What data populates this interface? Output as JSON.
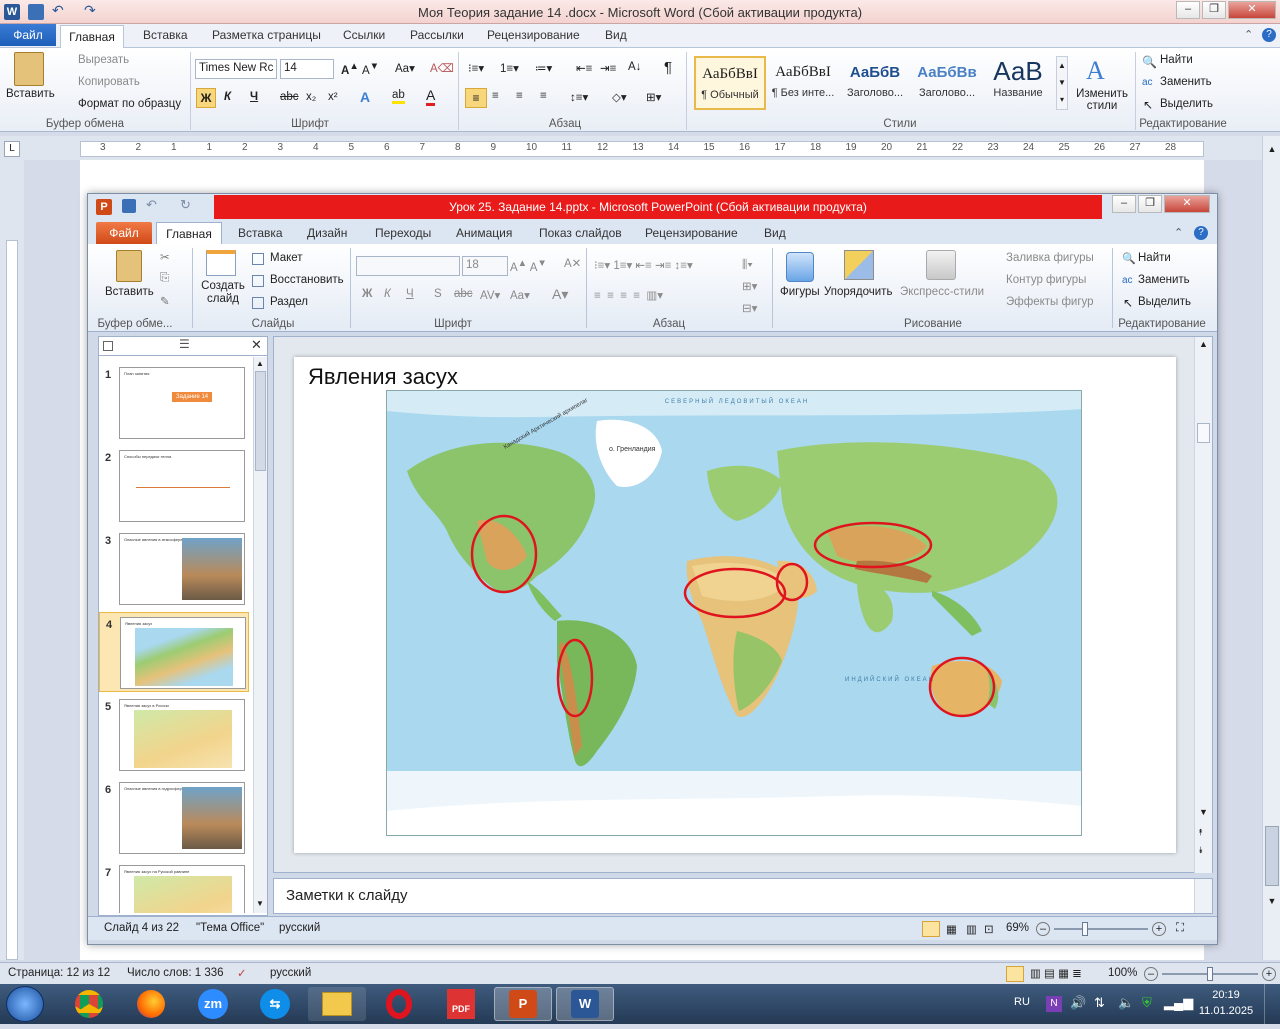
{
  "word": {
    "title": "Моя Теория задание 14 .docx  -  Microsoft Word (Сбой активации продукта)",
    "tabs": [
      "Файл",
      "Главная",
      "Вставка",
      "Разметка страницы",
      "Ссылки",
      "Рассылки",
      "Рецензирование",
      "Вид"
    ],
    "clipboard": {
      "paste": "Вставить",
      "cut": "Вырезать",
      "copy": "Копировать",
      "format": "Формат по образцу",
      "group": "Буфер обмена"
    },
    "font": {
      "name": "Times New Rc",
      "size": "14",
      "group": "Шрифт",
      "bold": "Ж",
      "italic": "К",
      "underline": "Ч"
    },
    "paragraph": {
      "group": "Абзац",
      "pilcrow": "¶"
    },
    "styles": {
      "group": "Стили",
      "items": [
        {
          "sample": "АаБбВвІ",
          "name": "¶ Обычный"
        },
        {
          "sample": "АаБбВвІ",
          "name": "¶ Без инте..."
        },
        {
          "sample": "АаБбВ",
          "name": "Заголово..."
        },
        {
          "sample": "АаБбВв",
          "name": "Заголово..."
        },
        {
          "sample": "АаВ",
          "name": "Название"
        }
      ],
      "change": "Изменить стили"
    },
    "editing": {
      "group": "Редактирование",
      "find": "Найти",
      "replace": "Заменить",
      "select": "Выделить"
    },
    "ruler_numbers": [
      "3",
      "2",
      "1",
      "1",
      "2",
      "3",
      "4",
      "5",
      "6",
      "7",
      "8",
      "9",
      "10",
      "11",
      "12",
      "13",
      "14",
      "15",
      "16",
      "17",
      "18",
      "19",
      "20",
      "21",
      "22",
      "23",
      "24",
      "25",
      "26",
      "27",
      "28"
    ],
    "status": {
      "page": "Страница: 12 из 12",
      "words": "Число слов: 1 336",
      "lang": "русский",
      "zoom": "100%"
    }
  },
  "ppt": {
    "title": "Урок 25. Задание 14.pptx  -  Microsoft PowerPoint (Сбой активации продукта)",
    "tabs": [
      "Файл",
      "Главная",
      "Вставка",
      "Дизайн",
      "Переходы",
      "Анимация",
      "Показ слайдов",
      "Рецензирование",
      "Вид"
    ],
    "clipboard": {
      "paste": "Вставить",
      "group": "Буфер обме..."
    },
    "slides": {
      "create": "Создать слайд",
      "layout": "Макет",
      "reset": "Восстановить",
      "section": "Раздел",
      "group": "Слайды"
    },
    "font": {
      "size": "18",
      "group": "Шрифт",
      "bold": "Ж",
      "italic": "К",
      "underline": "Ч",
      "shadow": "S",
      "strike": "abc"
    },
    "paragraph": {
      "group": "Абзац"
    },
    "drawing": {
      "shapes": "Фигуры",
      "arrange": "Упорядочить",
      "quick": "Экспресс-стили",
      "fill": "Заливка фигуры",
      "outline": "Контур фигуры",
      "effects": "Эффекты фигур",
      "group": "Рисование"
    },
    "editing": {
      "find": "Найти",
      "replace": "Заменить",
      "select": "Выделить",
      "group": "Редактирование"
    },
    "thumbs": [
      {
        "num": "1",
        "title": "План занятия",
        "tag": "Задание 14"
      },
      {
        "num": "2",
        "title": "Способы передачи тепла"
      },
      {
        "num": "3",
        "title": "Опасные явления в атмосфере"
      },
      {
        "num": "4",
        "title": "Явления засух"
      },
      {
        "num": "5",
        "title": "Явления засух в России"
      },
      {
        "num": "6",
        "title": "Опасные явления в гидросфере"
      },
      {
        "num": "7",
        "title": "Явления засух на Русской равнине"
      }
    ],
    "slide": {
      "title": "Явления засух",
      "map_labels": {
        "arctic": "СЕВЕРНЫЙ ЛЕДОВИТЫЙ ОКЕАН",
        "greenland": "о. Гренландия",
        "arch": "Канадский Арктический архипелаг",
        "indian": "ИНДИЙСКИЙ ОКЕАН"
      }
    },
    "notes": "Заметки к слайду",
    "status": {
      "slide": "Слайд 4 из 22",
      "theme": "\"Тема Office\"",
      "lang": "русский",
      "zoom": "69%"
    }
  },
  "taskbar": {
    "lang": "RU",
    "time": "20:19",
    "date": "11.01.2025"
  },
  "colors": {
    "word_blue": "#2b5797",
    "ppt_orange": "#d04a18",
    "ppt_redbar": "#e81a1a",
    "drought_ring": "#e0141e"
  }
}
